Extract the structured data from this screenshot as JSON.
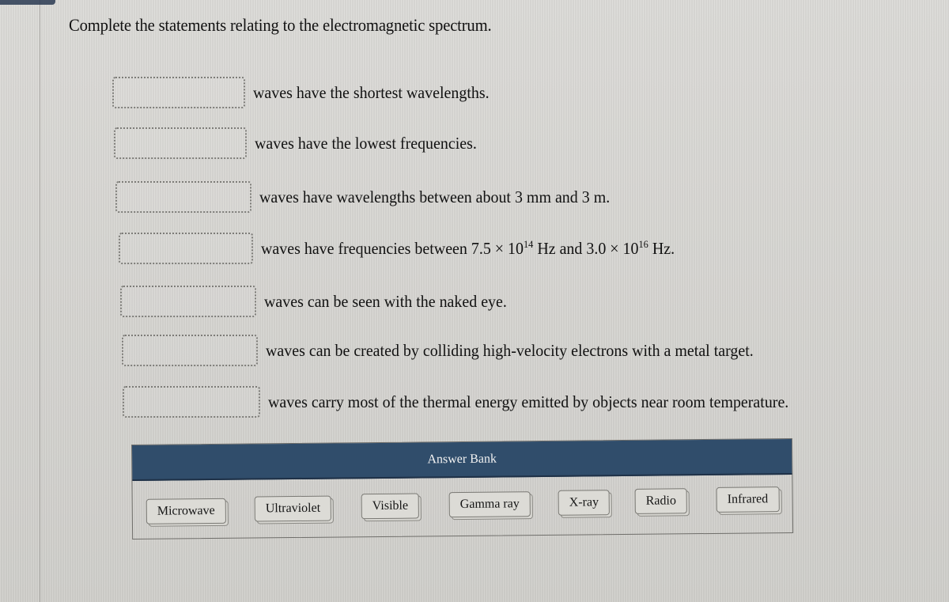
{
  "question": {
    "title": "Complete the statements relating to the electromagnetic spectrum."
  },
  "statements": [
    {
      "answer": "",
      "text": "waves have the shortest wavelengths."
    },
    {
      "answer": "",
      "text": "waves have the lowest frequencies."
    },
    {
      "answer": "",
      "text": "waves have wavelengths between about 3 mm and 3 m."
    },
    {
      "answer": "",
      "text_before": "waves have frequencies between 7.5 × 10",
      "sup1": "14",
      "text_mid": " Hz and 3.0 × 10",
      "sup2": "16",
      "text_after": " Hz."
    },
    {
      "answer": "",
      "text": "waves can be seen with the naked eye."
    },
    {
      "answer": "",
      "text": "waves can be created by colliding high-velocity electrons with a metal target."
    },
    {
      "answer": "",
      "text": "waves carry most of the thermal energy emitted by objects near room temperature."
    }
  ],
  "answer_bank": {
    "title": "Answer Bank",
    "items": [
      "Microwave",
      "Ultraviolet",
      "Visible",
      "Gamma ray",
      "X-ray",
      "Radio",
      "Infrared"
    ]
  },
  "colors": {
    "header_bg": "#304d6b",
    "header_text": "#f2f2f2"
  }
}
